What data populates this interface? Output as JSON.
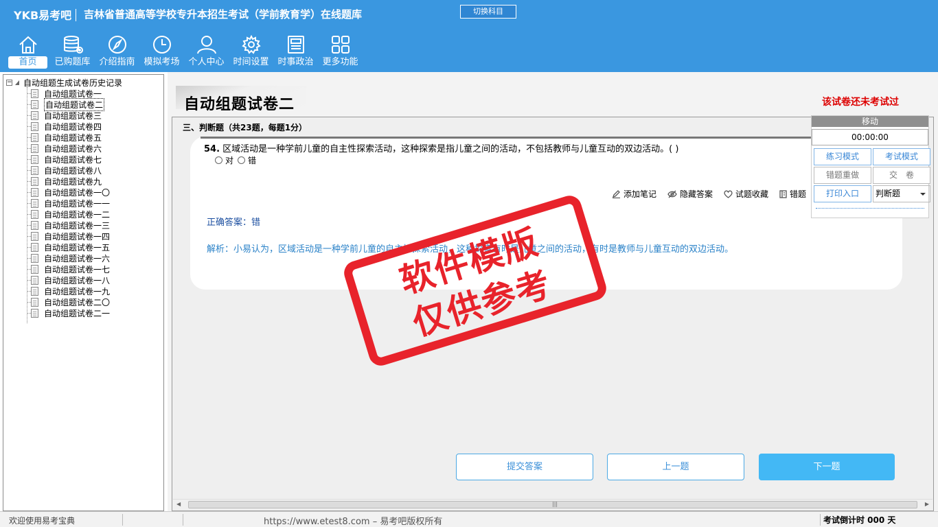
{
  "header": {
    "logo": "YKB易考吧",
    "title": "吉林省普通高等学校专升本招生考试（学前教育学）在线题库",
    "switch_subject": "切换科目"
  },
  "nav": [
    {
      "label": "首页",
      "icon": "home-icon"
    },
    {
      "label": "已购题库",
      "icon": "database-icon"
    },
    {
      "label": "介绍指南",
      "icon": "compass-icon"
    },
    {
      "label": "模拟考场",
      "icon": "clock-icon"
    },
    {
      "label": "个人中心",
      "icon": "user-icon"
    },
    {
      "label": "时间设置",
      "icon": "gear-icon"
    },
    {
      "label": "时事政治",
      "icon": "newspaper-icon"
    },
    {
      "label": "更多功能",
      "icon": "grid-icon"
    }
  ],
  "tree": {
    "root_toggle": "−",
    "root": "自动组题生成试卷历史记录",
    "items": [
      "自动组题试卷一",
      "自动组题试卷二",
      "自动组题试卷三",
      "自动组题试卷四",
      "自动组题试卷五",
      "自动组题试卷六",
      "自动组题试卷七",
      "自动组题试卷八",
      "自动组题试卷九",
      "自动组题试卷一〇",
      "自动组题试卷一一",
      "自动组题试卷一二",
      "自动组题试卷一三",
      "自动组题试卷一四",
      "自动组题试卷一五",
      "自动组题试卷一六",
      "自动组题试卷一七",
      "自动组题试卷一八",
      "自动组题试卷一九",
      "自动组题试卷二〇",
      "自动组题试卷二一"
    ]
  },
  "paper": {
    "title": "自动组题试卷二",
    "status": "该试卷还未考试过",
    "section": "三、判断题（共23题，每题1分）",
    "question_number": "54.",
    "question_text": "区域活动是一种学前儿童的自主性探索活动，这种探索是指儿童之间的活动，不包括教师与儿童互动的双边活动。( )",
    "option_true": "对",
    "option_false": "错",
    "answer": "正确答案：错",
    "analysis": "解析：小易认为，区域活动是一种学前儿童的自主性探索活动，这种探索有时是儿童之间的活动，有时是教师与儿童互动的双边活动。"
  },
  "actions": {
    "add_note": "添加笔记",
    "hide_answer": "隐藏答案",
    "favorite": "试题收藏",
    "wrong": "错题"
  },
  "side_panel": {
    "move": "移动",
    "timer": "00:00:00",
    "practice_mode": "练习模式",
    "exam_mode": "考试模式",
    "redo_wrong": "错题重做",
    "submit_paper": "交　卷",
    "print": "打印入口",
    "type_select": "判断题"
  },
  "buttons": {
    "submit_answer": "提交答案",
    "prev": "上一题",
    "next": "下一题"
  },
  "status_bar": {
    "welcome": "欢迎使用易考宝典",
    "copyright": "https://www.etest8.com – 易考吧版权所有",
    "countdown": "考试倒计时 000 天"
  },
  "watermark": {
    "line1": "软件模版",
    "line2": "仅供参考"
  },
  "colors": {
    "header_bg": "#3a97e0",
    "stamp_red": "#e8232b",
    "status_red": "#dd0000",
    "primary_button": "#43b8f5"
  }
}
